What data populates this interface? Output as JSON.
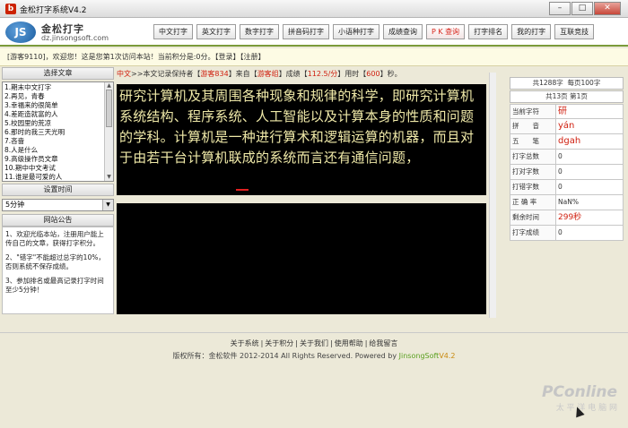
{
  "window": {
    "title": "金松打字系统V4.2",
    "icon_letter": "b",
    "min": "–",
    "max": "□",
    "close": "✕"
  },
  "header": {
    "logo_badge": "JS",
    "logo_main": "金松打字",
    "logo_sub": "dz.jinsongsoft.com",
    "nav": [
      "中文打字",
      "英文打字",
      "数字打字",
      "拼音码打字",
      "小语种打字",
      "成绩查询",
      "P K 查询",
      "打字排名",
      "我的打字",
      "互联竞技"
    ]
  },
  "notice": "[游客9110]，欢迎您！这是您第1次访问本站！当前积分是:0分。【登录】【注册】",
  "left": {
    "article_header": "选择文章",
    "articles": [
      "1.期末中文打字",
      "2.再见，青春",
      "3.幸福来的很简单",
      "4.差距造就富的人",
      "5.校园里的荒凉",
      "6.那时的我三天光明",
      "7.吝啬",
      "8.人是什么",
      "9.高级操作员文章",
      "10.期中中文考试",
      "11.谁是最可爱的人"
    ],
    "time_header": "设置时间",
    "time_value": "5分钟",
    "announce_header": "网站公告",
    "announcements": [
      "1、欢迎光临本站，注册用户能上传自己的文章，获得打字积分。",
      "2、\"错字\"不能超过总字的10%，否则系统不保存成绩。",
      "3、参加排名或最高记录打字时间至少5分钟！"
    ]
  },
  "meta": {
    "lang": "中文",
    "prefix": ">>本文记录保持者【",
    "holder": "游客834",
    "from_pre": "】来自【",
    "from": "游客组",
    "score_pre": "】成绩【",
    "score": "112.5/分",
    "time_pre": "】用时【",
    "time": "600",
    "time_suf": "】秒。"
  },
  "text": "研究计算机及其周围各种现象和规律的科学，即研究计算机系统结构、程序系统、人工智能以及计算本身的性质和问题的学科。计算机是一种进行算术和逻辑运算的机器，而且对于由若干台计算机联成的系统而言还有通信问题，",
  "stats": {
    "total": "共1288字",
    "per_page": "每页100字",
    "pages": "共13页 第1页",
    "rows": [
      {
        "k": "当前字符",
        "v": "研",
        "red": true
      },
      {
        "k": "拼　　音",
        "v": "yán",
        "red": true
      },
      {
        "k": "五　　笔",
        "v": "dgah",
        "red": true
      },
      {
        "k": "打字总数",
        "v": "0",
        "red": false
      },
      {
        "k": "打对字数",
        "v": "0",
        "red": false
      },
      {
        "k": "打错字数",
        "v": "0",
        "red": false
      },
      {
        "k": "正 确 率",
        "v": "NaN%",
        "red": false
      },
      {
        "k": "剩余时间",
        "v": "299秒",
        "red": true
      },
      {
        "k": "打字成绩",
        "v": "0",
        "red": false
      }
    ]
  },
  "footer": {
    "links": [
      "关于系统",
      "关于积分",
      "关于我们",
      "使用帮助",
      "给我留言"
    ],
    "copy": "版权所有：金松软件 2012-2014 All Rights Reserved. Powered by ",
    "brand": "JinsongSoft",
    "ver": "V4.2"
  },
  "watermark": {
    "line1": "PConline",
    "line2": "太 平 洋 电 脑 网"
  }
}
